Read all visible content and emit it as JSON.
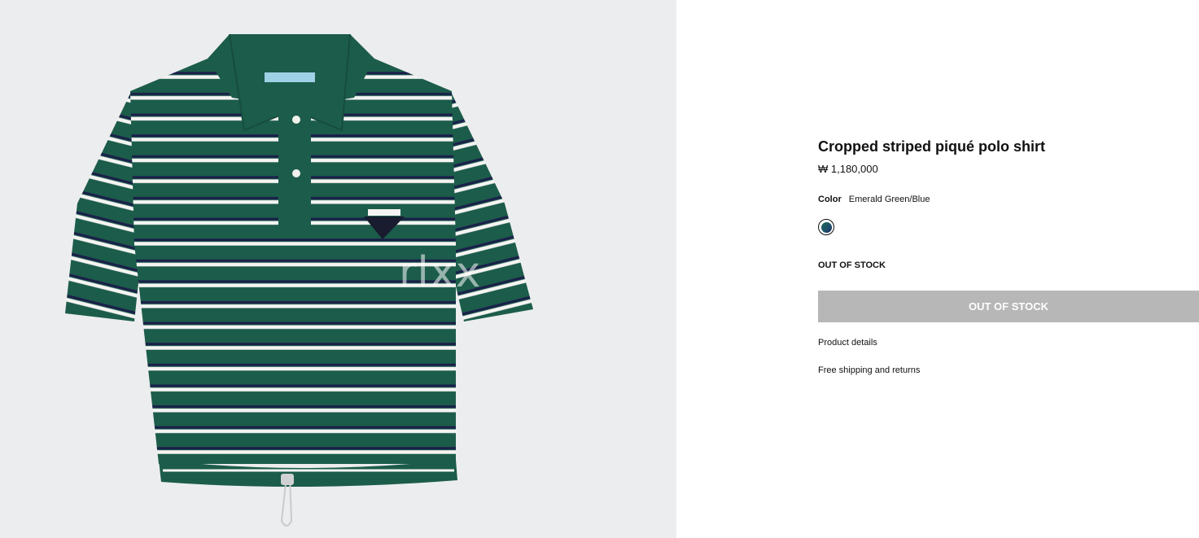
{
  "product": {
    "image_watermark": "rlxx",
    "title": "Cropped striped piqué polo shirt",
    "price": "₩ 1,180,000",
    "color_label": "Color",
    "color_value": "Emerald Green/Blue",
    "swatch_color": "#1b5e4c",
    "stock_status": "OUT OF STOCK",
    "buy_button_label": "OUT OF STOCK",
    "product_details_label": "Product details",
    "shipping_label": "Free shipping and returns"
  },
  "colors": {
    "image_background": "#ecedee",
    "shirt_green": "#1c5c4a",
    "button_disabled": "#b7b7b7"
  }
}
